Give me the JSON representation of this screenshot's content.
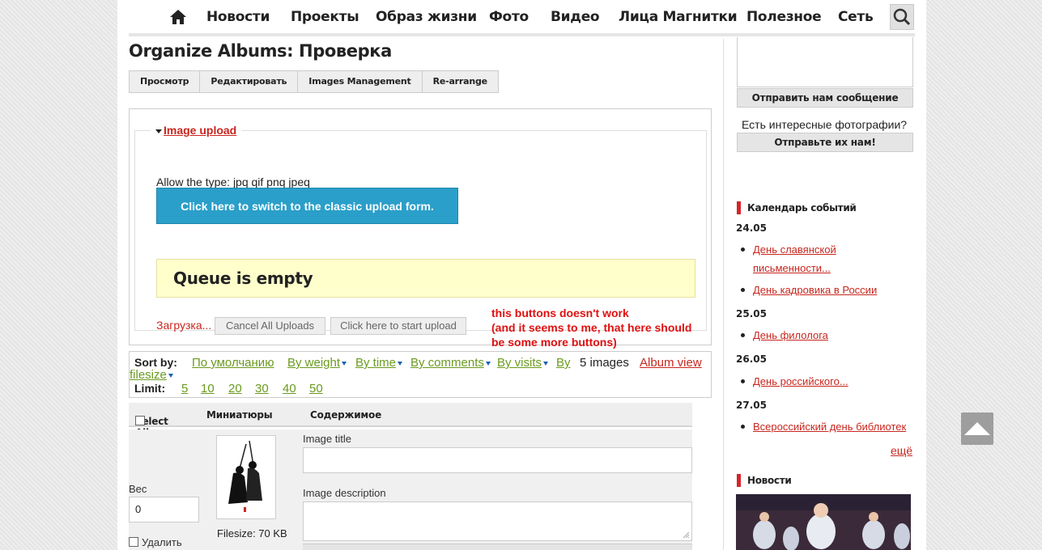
{
  "nav": {
    "items": [
      "Новости",
      "Проекты",
      "Образ жизни",
      "Фото",
      "Видео",
      "Лица Магнитки",
      "Полезное",
      "Сеть"
    ]
  },
  "main": {
    "title": "Organize Albums: Проверка",
    "tabs": [
      "Просмотр",
      "Редактировать",
      "Images Management",
      "Re-arrange"
    ],
    "upload": {
      "legend": "Image upload",
      "allow": "Allow the type: jpq qif pnq jpeq",
      "switch_button": "Click here to switch to the classic upload form.",
      "queue": "Queue is empty",
      "loading": "Загрузка...",
      "cancel_button": "Cancel All Uploads",
      "start_button": "Click here to start upload",
      "annotation": [
        "this buttons doesn't work",
        "(and it seems to me, that here should",
        "be some more buttons)"
      ]
    },
    "sort": {
      "label": "Sort by:",
      "default": "По умолчанию",
      "weight": "By weight",
      "time": "By time",
      "comments": "By comments",
      "visits": "By visits",
      "by": "By",
      "filesize": "filesize",
      "count": "5 images",
      "album_view": "Album view",
      "limit_label": "Limit:",
      "limits": [
        "5",
        "10",
        "20",
        "30",
        "40",
        "50"
      ]
    },
    "table": {
      "select_all": "Select All",
      "thumbs": "Миниатюры",
      "content": "Содержимое",
      "weight_label": "Вес",
      "weight_value": "0",
      "delete": "Удалить",
      "filesize": "Filesize: 70 KB",
      "image_title_label": "Image title",
      "image_description_label": "Image description"
    }
  },
  "sidebar": {
    "send_message": "Отправить нам сообщение",
    "question": "Есть интересные фотографии?",
    "send_photos": "Отправьте их нам!",
    "calendar_title": "Календарь событий",
    "events": [
      {
        "date": "24.05",
        "items": [
          [
            "День славянской",
            "письменности..."
          ],
          [
            "День кадровика в России"
          ]
        ]
      },
      {
        "date": "25.05",
        "items": [
          [
            "День филолога"
          ]
        ]
      },
      {
        "date": "26.05",
        "items": [
          [
            "День российского..."
          ]
        ]
      },
      {
        "date": "27.05",
        "items": [
          [
            "Всероссийский день библиотек"
          ]
        ]
      }
    ],
    "more": "ещё",
    "news_title": "Новости"
  },
  "colors": {
    "accent_red": "#c8261e",
    "link_green": "#6a9a1f",
    "switch_blue": "#2a9fc9",
    "queue_yellow": "#ffffcc"
  }
}
